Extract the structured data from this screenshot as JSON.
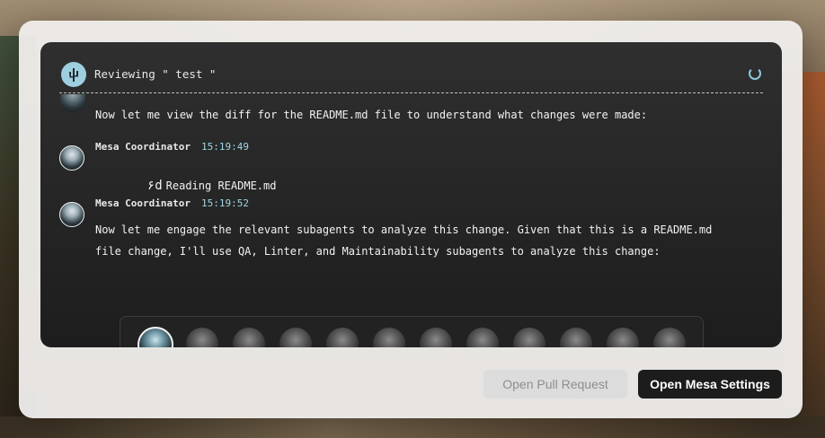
{
  "header": {
    "title": "Reviewing \" test \"",
    "logo_icon": "cactus-logo-icon",
    "spinner_icon": "loading-spinner-icon"
  },
  "messages": [
    {
      "text": "Now let me view the diff for the README.md file to understand what changes were made:"
    },
    {
      "author": "Mesa Coordinator",
      "time": "15:19:49",
      "icon": "glasses-icon",
      "text": "Reading README.md"
    },
    {
      "author": "Mesa Coordinator",
      "time": "15:19:52",
      "lines": [
        "Now let me engage the relevant subagents to analyze this change. Given that this is a README.md",
        "file change, I'll use QA, Linter, and Maintainability subagents to analyze this change:"
      ]
    }
  ],
  "agents": {
    "count": 12,
    "active_index": 0
  },
  "buttons": {
    "open_pr": "Open Pull Request",
    "open_settings": "Open Mesa Settings"
  },
  "colors": {
    "accent": "#9fd5e6",
    "panel_bg": "#1d1d1d",
    "primary_button": "#1c1c1c"
  }
}
